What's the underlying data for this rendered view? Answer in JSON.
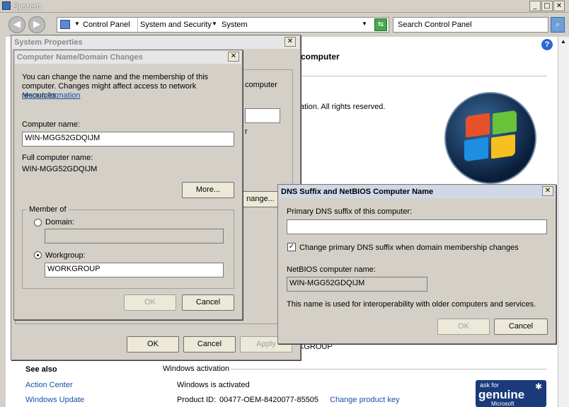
{
  "window": {
    "title": "System",
    "minimize": "_",
    "maximize": "□",
    "close": "✕"
  },
  "nav": {
    "breadcrumbs": [
      "Control Panel",
      "System and Security",
      "System"
    ],
    "search_placeholder": "Search Control Panel"
  },
  "main": {
    "heading_fragment": "computer",
    "copyright_fragment": "ation.  All rights reserved.",
    "workgroup_fragment": "KGROUP",
    "see_also": {
      "title": "See also",
      "items": [
        "Action Center",
        "Windows Update"
      ]
    },
    "activation": {
      "section": "Windows activation",
      "status": "Windows is activated",
      "product_id_label": "Product ID:",
      "product_id": "00477-OEM-8420077-85505",
      "change_key": "Change product key"
    },
    "genuine": {
      "line1": "ask for",
      "line2": "genuine",
      "line3": "Microsoft"
    }
  },
  "system_properties": {
    "title": "System Properties",
    "computer_fragment": "computer",
    "change_fragment": "nange...",
    "ok": "OK",
    "cancel": "Cancel",
    "apply": "Apply"
  },
  "name_changes": {
    "title": "Computer Name/Domain Changes",
    "description": "You can change the name and the membership of this computer. Changes might affect access to network resources.",
    "more_info": "More information",
    "computer_name_label": "Computer name:",
    "computer_name_value": "WIN-MGG52GDQIJM",
    "full_name_label": "Full computer name:",
    "full_name_value": "WIN-MGG52GDQIJM",
    "more_button": "More...",
    "member_of": "Member of",
    "domain_label": "Domain:",
    "domain_value": "",
    "workgroup_label": "Workgroup:",
    "workgroup_value": "WORKGROUP",
    "ok": "OK",
    "cancel": "Cancel"
  },
  "dns_dialog": {
    "title": "DNS Suffix and NetBIOS Computer Name",
    "primary_label": "Primary DNS suffix of this computer:",
    "primary_value": "",
    "checkbox_label": "Change primary DNS suffix when domain membership changes",
    "checkbox_checked": true,
    "netbios_label": "NetBIOS computer name:",
    "netbios_value": "WIN-MGG52GDQIJM",
    "note": "This name is used for interoperability with older computers and services.",
    "ok": "OK",
    "cancel": "Cancel"
  },
  "colors": {
    "link": "#1651a8",
    "dialog_bg": "#d4d0c8",
    "active_title": "#d0d8e8"
  }
}
